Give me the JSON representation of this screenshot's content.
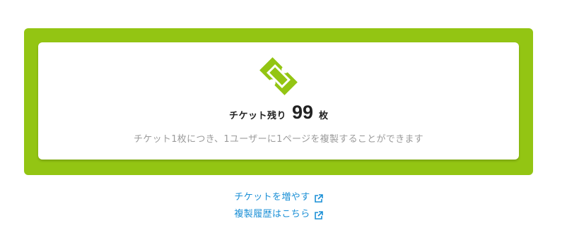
{
  "ticket_card": {
    "icon": "ticket-icon",
    "remaining_label": "チケット残り",
    "remaining_count": "99",
    "remaining_unit": "枚",
    "description": "チケット1枚につき、1ユーザーに1ページを複製することができます"
  },
  "links": {
    "add_tickets": "チケットを増やす",
    "history": "複製履歴はこちら",
    "icon": "external-link-icon"
  },
  "colors": {
    "accent_green": "#93c513",
    "link_blue": "#1a8fd6"
  }
}
